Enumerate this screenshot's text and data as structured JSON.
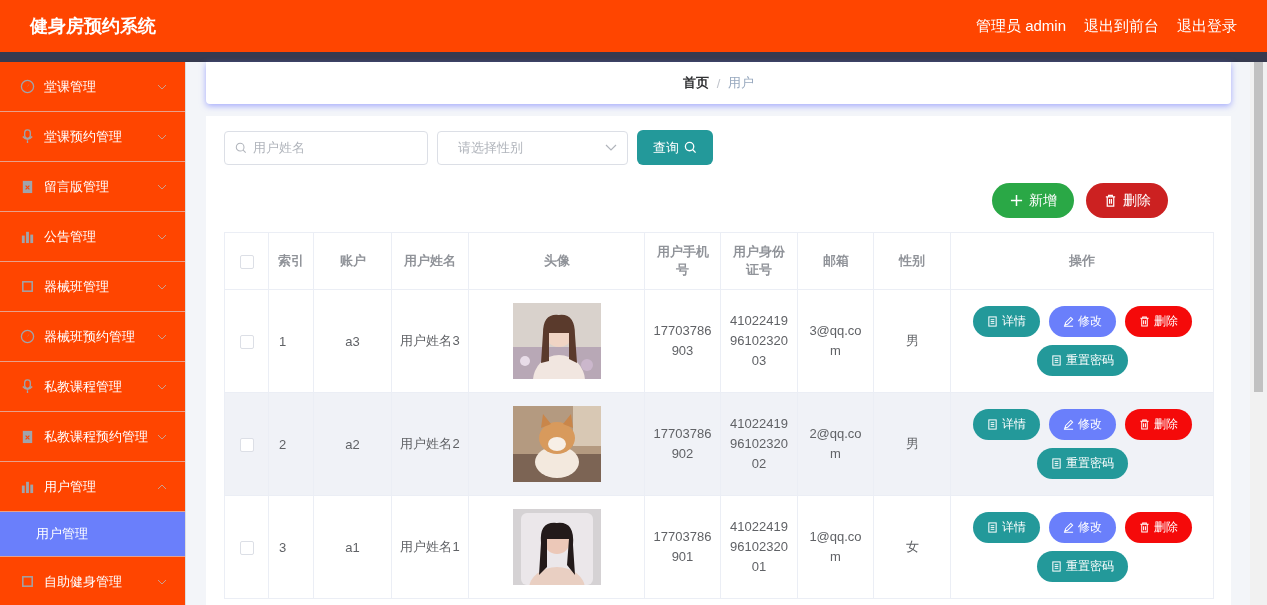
{
  "header": {
    "title": "健身房预约系统",
    "links": [
      "管理员 admin",
      "退出到前台",
      "退出登录"
    ]
  },
  "sidebar": {
    "items": [
      {
        "label": "堂课管理",
        "expanded": false
      },
      {
        "label": "堂课预约管理",
        "expanded": false
      },
      {
        "label": "留言版管理",
        "expanded": false
      },
      {
        "label": "公告管理",
        "expanded": false
      },
      {
        "label": "器械班管理",
        "expanded": false
      },
      {
        "label": "器械班预约管理",
        "expanded": false
      },
      {
        "label": "私教课程管理",
        "expanded": false
      },
      {
        "label": "私教课程预约管理",
        "expanded": false
      },
      {
        "label": "用户管理",
        "expanded": true,
        "children": [
          {
            "label": "用户管理",
            "selected": true
          }
        ]
      },
      {
        "label": "自助健身管理",
        "expanded": false
      }
    ]
  },
  "breadcrumb": {
    "items": [
      "首页",
      "用户"
    ],
    "separator": "/"
  },
  "filters": {
    "name": {
      "placeholder": "用户姓名"
    },
    "gender": {
      "placeholder": "请选择性别"
    },
    "search_button": "查询"
  },
  "toolbar": {
    "add_button": "新增",
    "delete_button": "删除"
  },
  "table": {
    "columns": [
      "索引",
      "账户",
      "用户姓名",
      "头像",
      "用户手机号",
      "用户身份证号",
      "邮箱",
      "性别",
      "操作"
    ],
    "all_checked": false,
    "rows": [
      {
        "checked": false,
        "highlighted": false,
        "cells": [
          "1",
          "a3",
          "用户姓名3",
          "",
          "17703786903",
          "410224199610232003",
          "3@qq.com",
          "男"
        ],
        "actions": [
          {
            "kind": "detail",
            "label": "详情"
          },
          {
            "kind": "edit",
            "label": "修改"
          },
          {
            "kind": "delete",
            "label": "删除"
          },
          {
            "kind": "reset",
            "label": "重置密码"
          }
        ]
      },
      {
        "checked": false,
        "highlighted": true,
        "cells": [
          "2",
          "a2",
          "用户姓名2",
          "",
          "17703786902",
          "410224199610232002",
          "2@qq.com",
          "男"
        ],
        "actions": [
          {
            "kind": "detail",
            "label": "详情"
          },
          {
            "kind": "edit",
            "label": "修改"
          },
          {
            "kind": "delete",
            "label": "删除"
          },
          {
            "kind": "reset",
            "label": "重置密码"
          }
        ]
      },
      {
        "checked": false,
        "highlighted": false,
        "cells": [
          "3",
          "a1",
          "用户姓名1",
          "",
          "17703786901",
          "410224199610232001",
          "1@qq.com",
          "女"
        ],
        "actions": [
          {
            "kind": "detail",
            "label": "详情"
          },
          {
            "kind": "edit",
            "label": "修改"
          },
          {
            "kind": "delete",
            "label": "删除"
          },
          {
            "kind": "reset",
            "label": "重置密码"
          }
        ]
      }
    ]
  }
}
